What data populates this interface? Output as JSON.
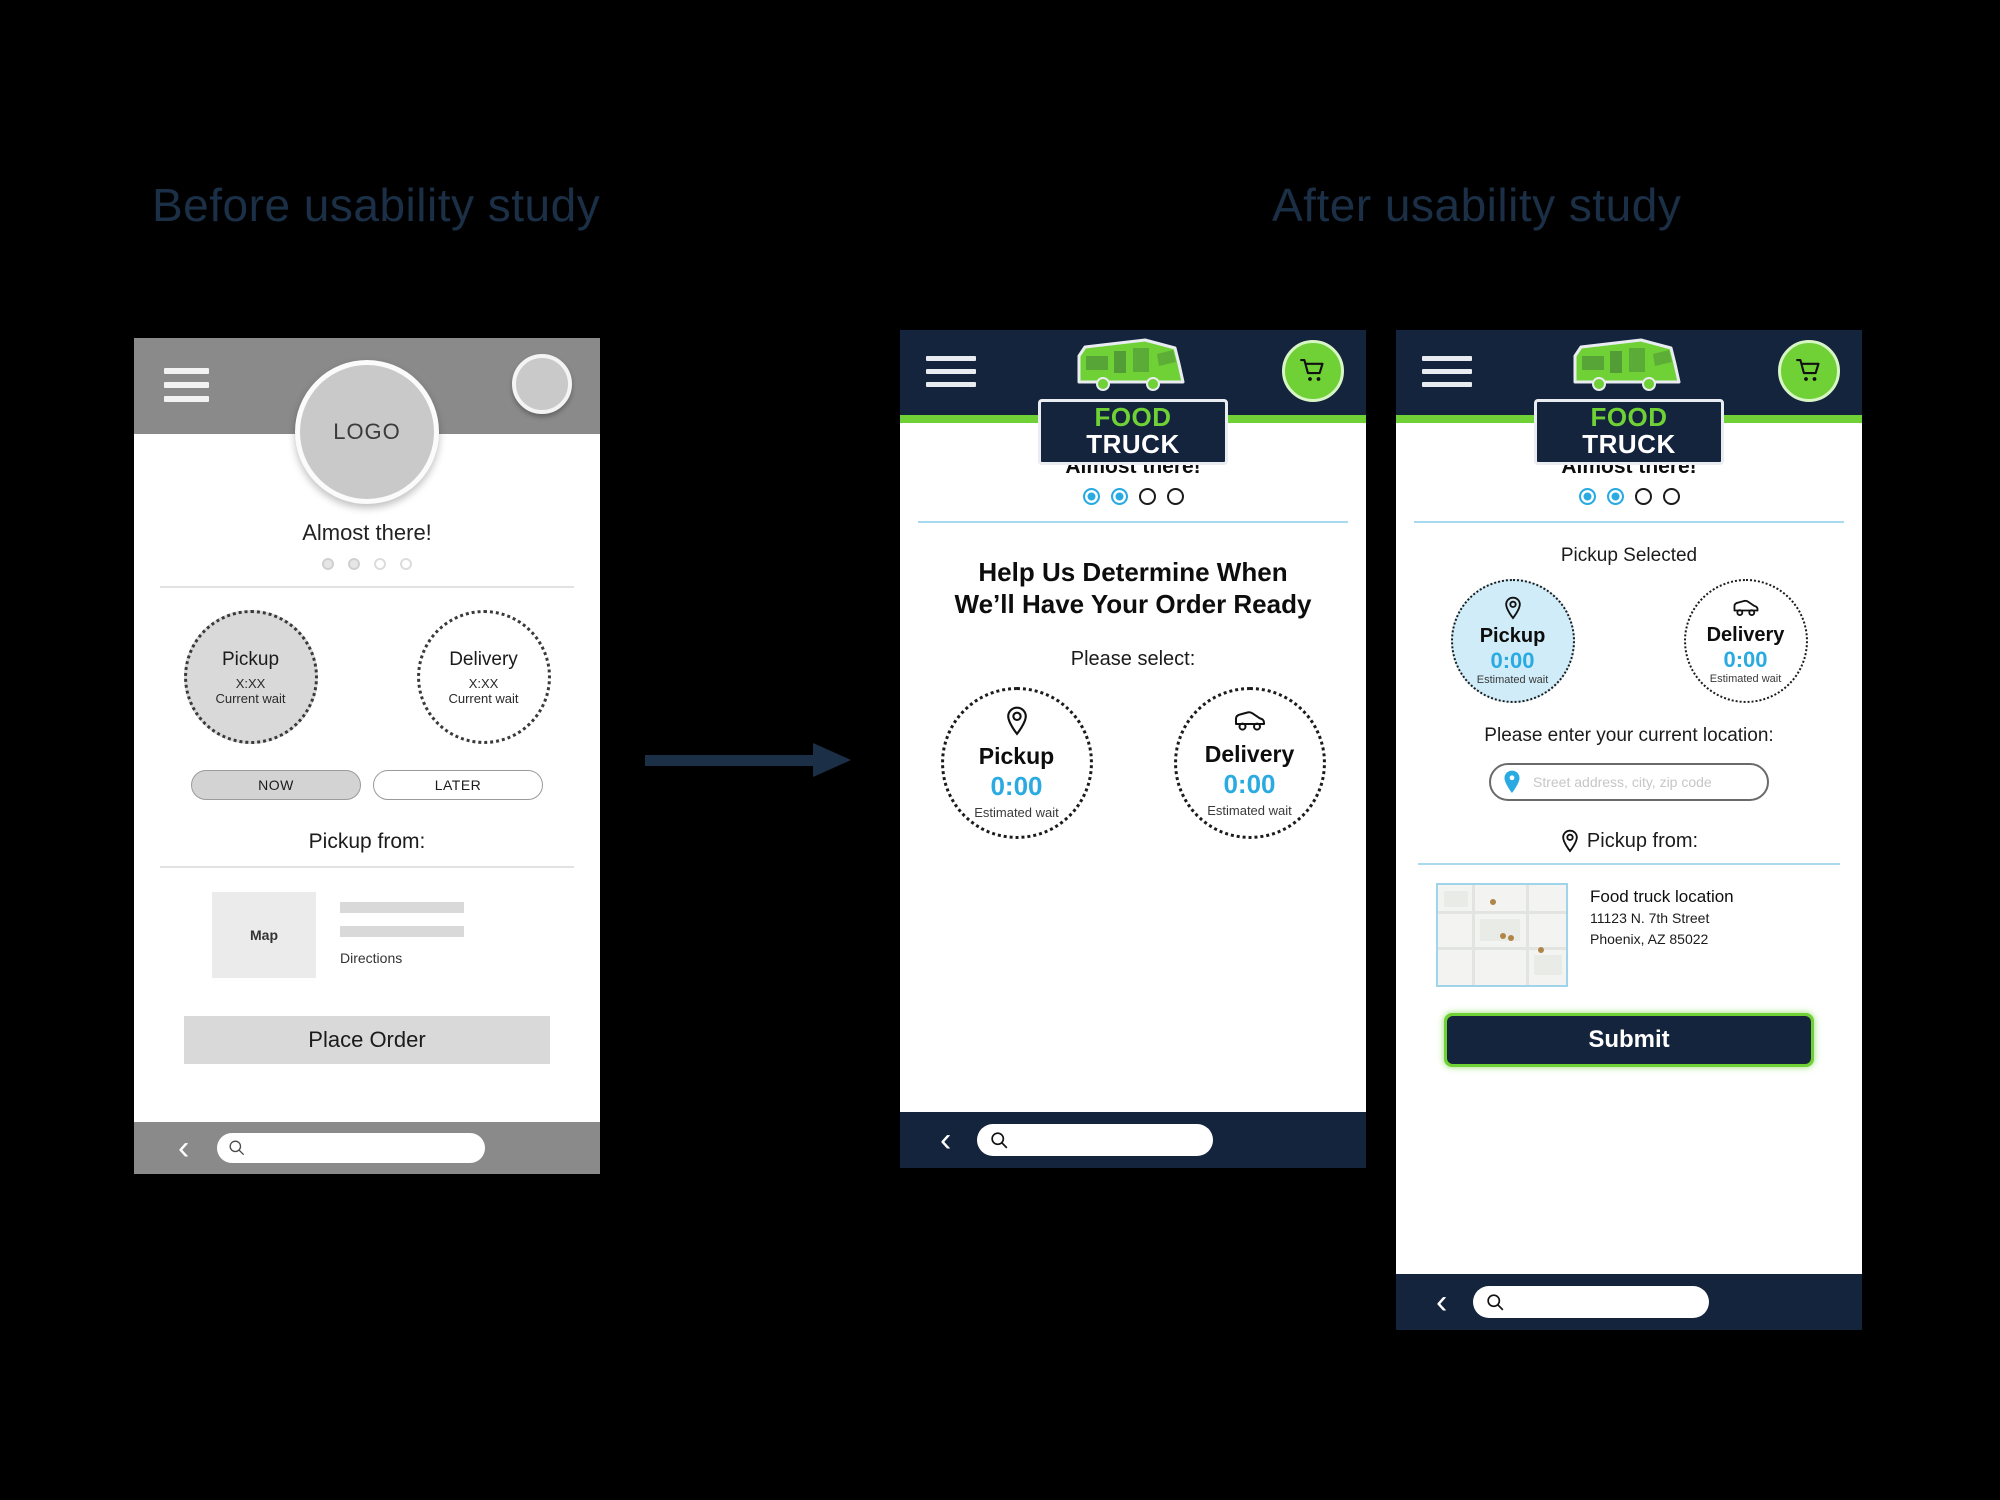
{
  "headings": {
    "before": "Before usability study",
    "after": "After usability study"
  },
  "colors": {
    "navy": "#14243c",
    "green": "#6fd136",
    "blue": "#29abe2",
    "heading_navy": "#1b3047",
    "wire_gray": "#8a8a8a"
  },
  "arrow": {
    "name": "transition-arrow"
  },
  "wireframe": {
    "logo_label": "LOGO",
    "almost_there": "Almost there!",
    "dots": [
      true,
      true,
      false,
      false
    ],
    "pickup": {
      "title": "Pickup",
      "time": "X:XX",
      "wait_label": "Current wait",
      "selected": true
    },
    "delivery": {
      "title": "Delivery",
      "time": "X:XX",
      "wait_label": "Current wait",
      "selected": false
    },
    "toggle_now": "NOW",
    "toggle_later": "LATER",
    "pickup_from": "Pickup from:",
    "map_label": "Map",
    "directions": "Directions",
    "place_order": "Place Order"
  },
  "mid": {
    "brand_food": "FOOD",
    "brand_truck": "TRUCK",
    "almost_there": "Almost there!",
    "dots": [
      true,
      true,
      false,
      false
    ],
    "headline_line1": "Help Us Determine When",
    "headline_line2": "We’ll Have Your Order Ready",
    "please_select": "Please select:",
    "pickup": {
      "title": "Pickup",
      "time": "0:00",
      "wait_label": "Estimated wait",
      "selected": false
    },
    "delivery": {
      "title": "Delivery",
      "time": "0:00",
      "wait_label": "Estimated wait",
      "selected": false
    }
  },
  "after": {
    "brand_food": "FOOD",
    "brand_truck": "TRUCK",
    "almost_there": "Almost there!",
    "dots": [
      true,
      true,
      false,
      false
    ],
    "pickup_selected": "Pickup Selected",
    "pickup": {
      "title": "Pickup",
      "time": "0:00",
      "wait_label": "Estimated wait",
      "selected": true
    },
    "delivery": {
      "title": "Delivery",
      "time": "0:00",
      "wait_label": "Estimated wait",
      "selected": false
    },
    "enter_location_label": "Please enter your current location:",
    "location_input_placeholder": "Street address, city, zip code",
    "location_input_value": "",
    "pickup_from": "Pickup from:",
    "location_name": "Food truck location",
    "location_street": "11123 N. 7th Street",
    "location_city": "Phoenix, AZ 85022",
    "submit_label": "Submit"
  }
}
